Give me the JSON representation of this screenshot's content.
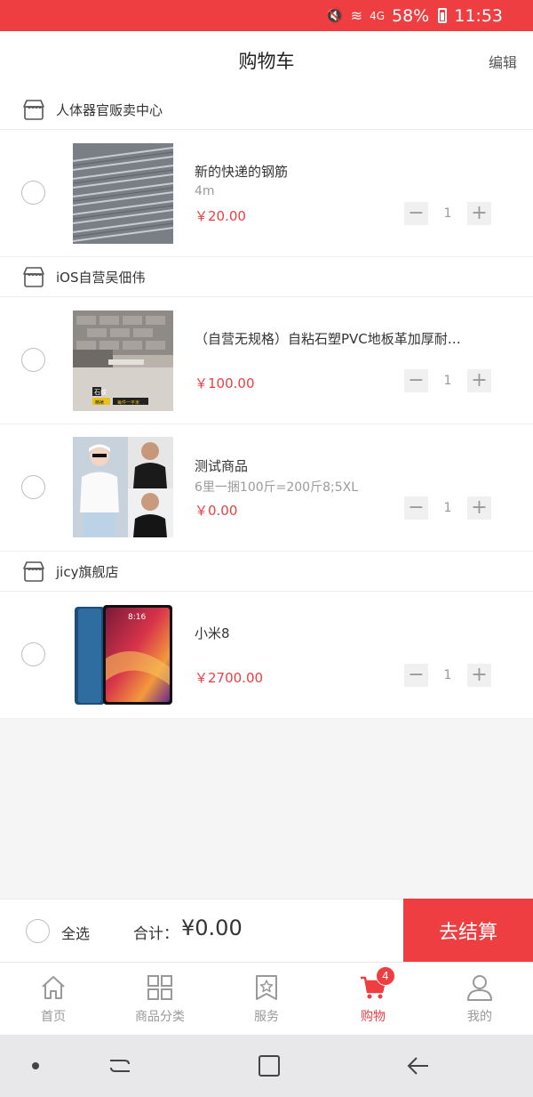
{
  "status_bar": {
    "battery": "58%",
    "time": "11:53",
    "network": "4G"
  },
  "header": {
    "title": "购物车",
    "edit_label": "编辑"
  },
  "colors": {
    "accent": "#ef3e42"
  },
  "shops": [
    {
      "name": "人体器官贩卖中心",
      "items": [
        {
          "title": "新的快递的钢筋",
          "spec": "4m",
          "price": "￥20.00",
          "qty": "1",
          "image": "steel-bars"
        }
      ]
    },
    {
      "name": "iOS自营吴佃伟",
      "items": [
        {
          "title": "（自营无规格）自粘石塑PVC地板革加厚耐…",
          "spec": "",
          "price": "￥100.00",
          "qty": "1",
          "image": "floor-tile"
        },
        {
          "title": "测试商品",
          "spec": "6里一捆100斤=200斤8;5XL",
          "price": "￥0.00",
          "qty": "1",
          "image": "tshirt-models"
        }
      ]
    },
    {
      "name": "jicy旗舰店",
      "items": [
        {
          "title": "小米8",
          "spec": "",
          "price": "￥2700.00",
          "qty": "1",
          "image": "phone"
        }
      ]
    }
  ],
  "thumb_text": {
    "floor_line1": "石纹",
    "floor_line2": "精裱",
    "floor_line3": "每件一平米",
    "phone_time": "8:16"
  },
  "checkout": {
    "select_all_label": "全选",
    "total_label": "合计：",
    "total_value": "¥0.00",
    "button_label": "去结算"
  },
  "tabbar": {
    "tabs": [
      {
        "label": "首页",
        "icon": "home-icon"
      },
      {
        "label": "商品分类",
        "icon": "grid-icon"
      },
      {
        "label": "服务",
        "icon": "bookmark-star-icon"
      },
      {
        "label": "购物",
        "icon": "cart-icon",
        "active": true,
        "badge": "4"
      },
      {
        "label": "我的",
        "icon": "user-icon"
      }
    ]
  }
}
